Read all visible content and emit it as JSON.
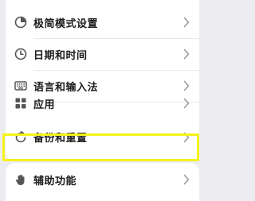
{
  "settings": {
    "items": [
      {
        "label": "极简模式设置",
        "icon": "minimal-mode-icon"
      },
      {
        "label": "日期和时间",
        "icon": "clock-icon"
      },
      {
        "label": "语言和输入法",
        "icon": "keyboard-icon"
      },
      {
        "label": "应用",
        "icon": "apps-grid-icon"
      },
      {
        "label": "备份和重置",
        "icon": "backup-reset-icon"
      },
      {
        "label": "辅助功能",
        "icon": "hand-icon"
      }
    ]
  },
  "colors": {
    "background": "#ededf1",
    "card": "#ffffff",
    "highlight": "#f5f21c",
    "text": "#1c1c1c",
    "icon": "#555555",
    "chevron": "#9a9a9f"
  }
}
